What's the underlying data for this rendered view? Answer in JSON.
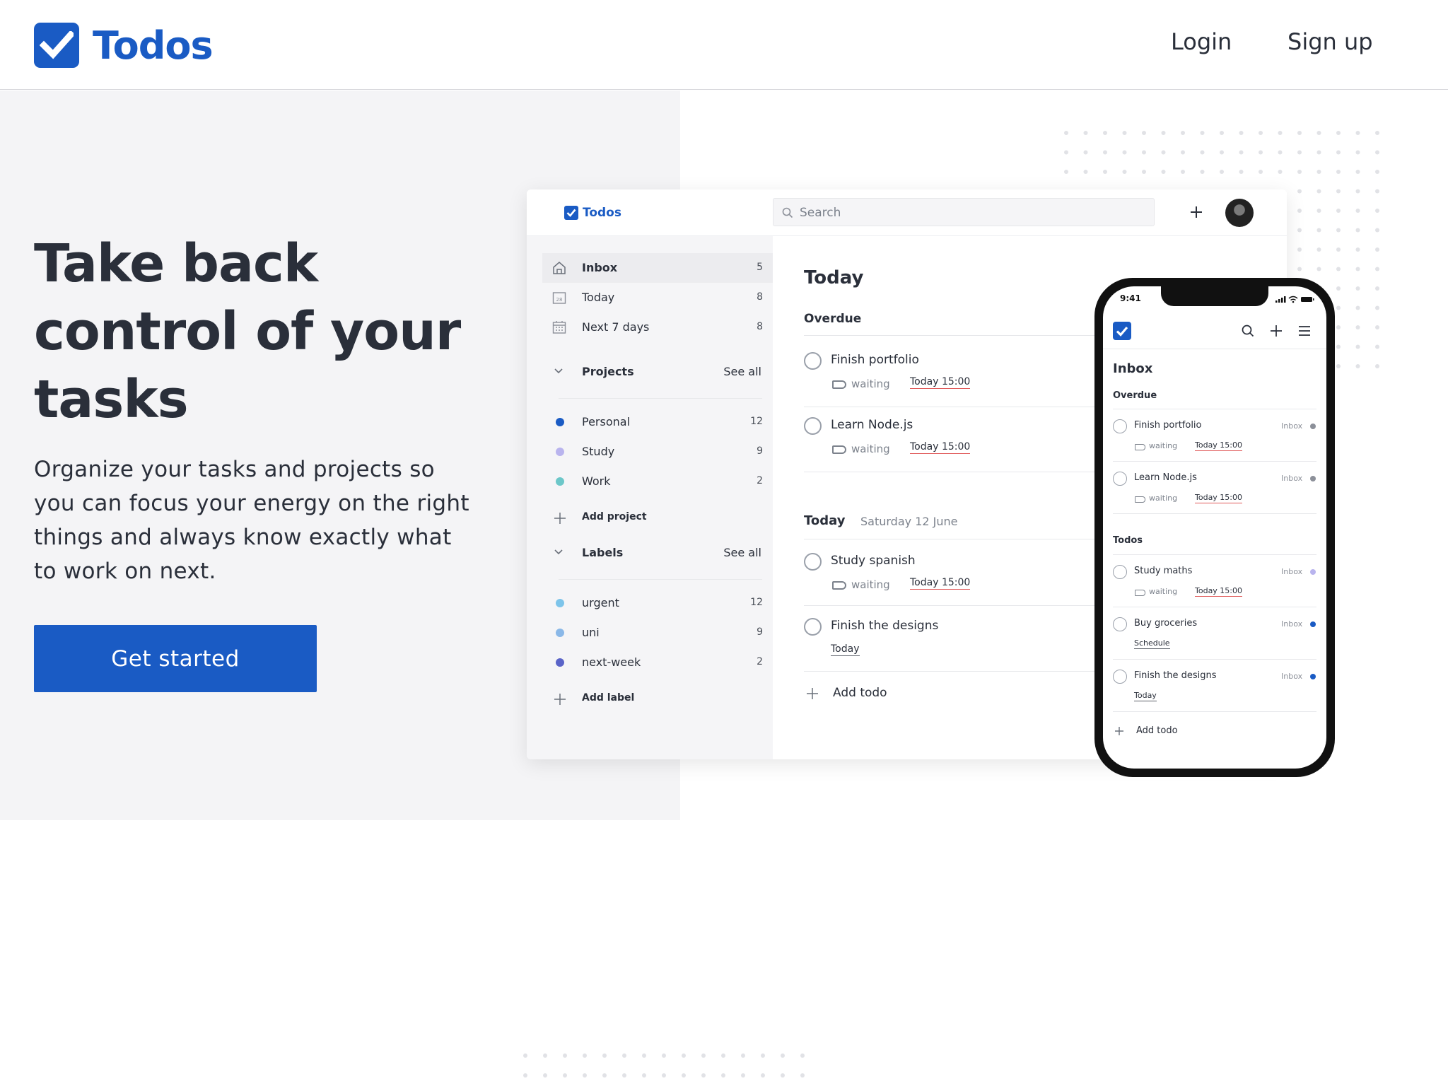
{
  "brand": {
    "name": "Todos",
    "color": "#1a5bc4"
  },
  "nav": {
    "login": "Login",
    "signup": "Sign up"
  },
  "hero": {
    "title_lines": [
      "Take back",
      "control of your",
      "tasks"
    ],
    "subtitle_lines": [
      "Organize your tasks and projects so",
      "you can focus your energy on the right",
      "things and always know exactly what",
      "to work on next."
    ],
    "cta": "Get started"
  },
  "app": {
    "brand": "Todos",
    "search_placeholder": "Search",
    "sidebar": {
      "nav": [
        {
          "label": "Inbox",
          "count": "5",
          "icon": "home-icon"
        },
        {
          "label": "Today",
          "count": "8",
          "icon": "calendar-day-icon"
        },
        {
          "label": "Next 7 days",
          "count": "8",
          "icon": "calendar-icon"
        }
      ],
      "projects_heading": "Projects",
      "projects_see_all": "See all",
      "projects": [
        {
          "label": "Personal",
          "count": "12",
          "color": "#1a5bc4"
        },
        {
          "label": "Study",
          "count": "9",
          "color": "#b9b4ee"
        },
        {
          "label": "Work",
          "count": "2",
          "color": "#6cc7c9"
        }
      ],
      "add_project": "Add project",
      "labels_heading": "Labels",
      "labels_see_all": "See all",
      "labels": [
        {
          "label": "urgent",
          "count": "12",
          "color": "#7dc4ea"
        },
        {
          "label": "uni",
          "count": "9",
          "color": "#8ab8e8"
        },
        {
          "label": "next-week",
          "count": "2",
          "color": "#5a64c8"
        }
      ],
      "add_label": "Add label"
    },
    "main": {
      "title": "Today",
      "overdue_heading": "Overdue",
      "overdue": [
        {
          "title": "Finish portfolio",
          "tag": "waiting",
          "due": "Today 15:00"
        },
        {
          "title": "Learn Node.js",
          "tag": "waiting",
          "due": "Today 15:00"
        }
      ],
      "today_heading": "Today",
      "today_date": "Saturday 12 June",
      "today": [
        {
          "title": "Study spanish",
          "tag": "waiting",
          "due": "Today 15:00"
        },
        {
          "title": "Finish the designs",
          "due": "Today"
        }
      ],
      "add_todo": "Add todo"
    }
  },
  "phone": {
    "time": "9:41",
    "title": "Inbox",
    "overdue_heading": "Overdue",
    "overdue": [
      {
        "title": "Finish portfolio",
        "project": "Inbox",
        "tag": "waiting",
        "due": "Today 15:00",
        "color": "#8c9099"
      },
      {
        "title": "Learn Node.js",
        "project": "Inbox",
        "tag": "waiting",
        "due": "Today 15:00",
        "color": "#8c9099"
      }
    ],
    "todos_heading": "Todos",
    "todos": [
      {
        "title": "Study maths",
        "project": "Inbox",
        "tag": "waiting",
        "due": "Today 15:00",
        "color": "#b9b4ee"
      },
      {
        "title": "Buy groceries",
        "project": "Inbox",
        "due": "Schedule",
        "color": "#1a5bc4"
      },
      {
        "title": "Finish the designs",
        "project": "Inbox",
        "due": "Today",
        "color": "#1a5bc4"
      }
    ],
    "add_todo": "Add todo"
  }
}
